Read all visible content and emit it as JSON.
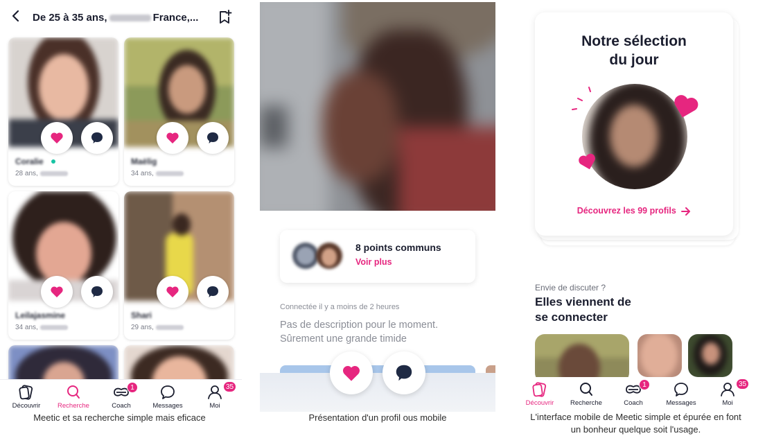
{
  "panel1": {
    "header": {
      "title_start": "De 25 à 35 ans,",
      "title_end": "France,..."
    },
    "cards": [
      {
        "name": "Coralie",
        "age": "28 ans,"
      },
      {
        "name": "Maëlig",
        "age": "34 ans,"
      },
      {
        "name": "Leilajasmine",
        "age": "34 ans,"
      },
      {
        "name": "Shari",
        "age": "29 ans,"
      }
    ],
    "nav": [
      {
        "label": "Découvrir"
      },
      {
        "label": "Recherche"
      },
      {
        "label": "Coach",
        "badge": "1"
      },
      {
        "label": "Messages"
      },
      {
        "label": "Moi",
        "badge": "35"
      }
    ],
    "caption": "Meetic et sa recherche simple mais eficace"
  },
  "panel2": {
    "common_title": "8 points communs",
    "common_link": "Voir plus",
    "status": "Connectée il y a moins de 2 heures",
    "description_line1": "Pas de description pour le moment.",
    "description_line2": "Sûrement une grande timide",
    "caption": "Présentation d'un profil ous mobile"
  },
  "panel3": {
    "selection_line1": "Notre sélection",
    "selection_line2": "du jour",
    "selection_link": "Découvrez les 99 profils",
    "subheading": "Envie de discuter ?",
    "heading_line1": "Elles viennent de",
    "heading_line2": "se connecter",
    "nav": [
      {
        "label": "Découvrir"
      },
      {
        "label": "Recherche"
      },
      {
        "label": "Coach",
        "badge": "1"
      },
      {
        "label": "Messages"
      },
      {
        "label": "Moi",
        "badge": "35"
      }
    ],
    "caption_line1": "L'interface mobile de Meetic simple et épurée en font",
    "caption_line2": "un bonheur quelque soit l'usage."
  },
  "colors": {
    "accent": "#e6267f",
    "text": "#1a1d2e",
    "online": "#18c4a4",
    "icon_dark": "#1f2a44"
  },
  "icons": [
    "back-icon",
    "bookmark-add-icon",
    "heart-icon",
    "chat-bubble-icon",
    "discover-icon",
    "search-icon",
    "coach-icon",
    "messages-icon",
    "profile-icon",
    "arrow-right-icon"
  ]
}
